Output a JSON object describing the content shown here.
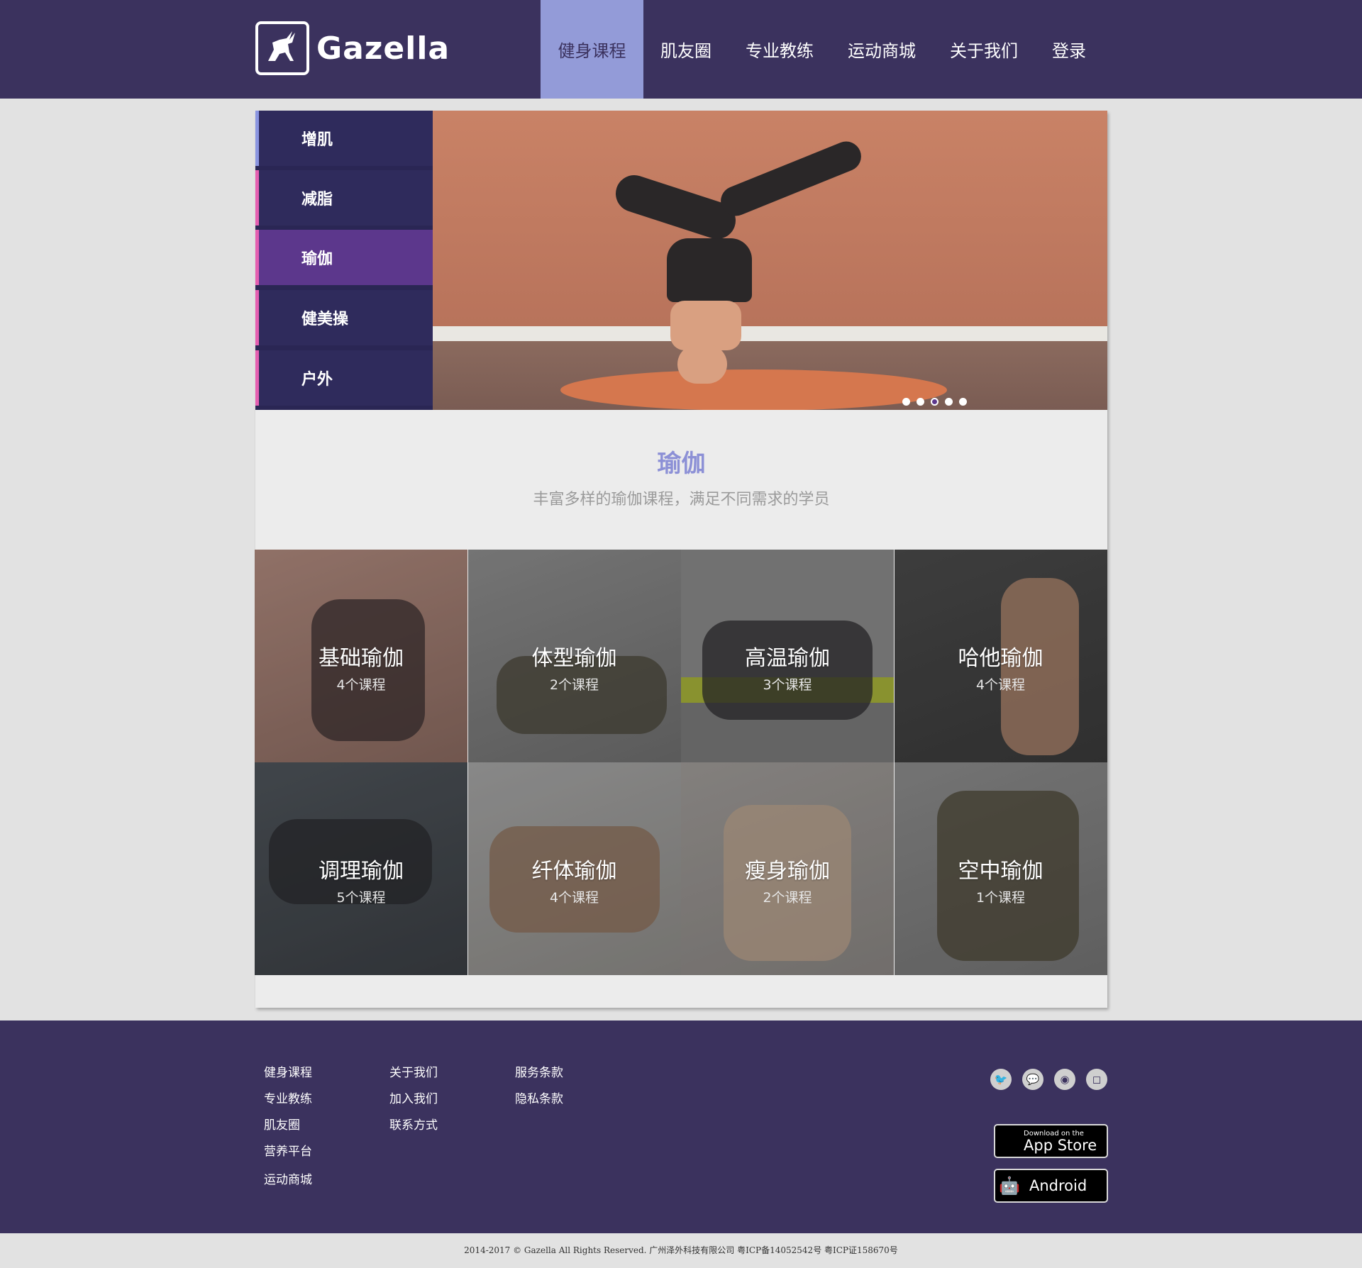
{
  "header": {
    "logo_text": "Gazella",
    "nav": [
      "健身课程",
      "肌友圈",
      "专业教练",
      "运动商城",
      "关于我们",
      "登录"
    ],
    "active_index": 0
  },
  "side_menu": [
    "增肌",
    "减脂",
    "瑜伽",
    "健美操",
    "户外"
  ],
  "side_menu_active": 2,
  "carousel": {
    "slide_count": 5,
    "active_slide": 2
  },
  "section": {
    "title": "瑜伽",
    "subtitle": "丰富多样的瑜伽课程，满足不同需求的学员"
  },
  "courses": [
    {
      "name": "基础瑜伽",
      "count": "4个课程"
    },
    {
      "name": "体型瑜伽",
      "count": "2个课程"
    },
    {
      "name": "高温瑜伽",
      "count": "3个课程"
    },
    {
      "name": "哈他瑜伽",
      "count": "4个课程"
    },
    {
      "name": "调理瑜伽",
      "count": "5个课程"
    },
    {
      "name": "纤体瑜伽",
      "count": "4个课程"
    },
    {
      "name": "瘦身瑜伽",
      "count": "2个课程"
    },
    {
      "name": "空中瑜伽",
      "count": "1个课程"
    }
  ],
  "footer": {
    "col1": [
      "健身课程",
      "专业教练",
      "肌友圈",
      "营养平台",
      "运动商城"
    ],
    "col2": [
      "关于我们",
      "加入我们",
      "联系方式"
    ],
    "col3": [
      "服务条款",
      "隐私条款"
    ],
    "socials": [
      "twitter-icon",
      "wechat-icon",
      "weibo-icon",
      "instagram-icon"
    ],
    "app_store": {
      "small": "Download on the",
      "big": "App Store"
    },
    "android": {
      "big": "Android"
    }
  },
  "copyright": "2014-2017 © Gazella All Rights Reserved. 广州泽外科技有限公司 粤ICP备14052542号 粤ICP证158670号",
  "colors": {
    "brand": "#3b325e",
    "nav_active": "#939bd8",
    "accent": "#5c378c",
    "pink": "#e45fb1"
  }
}
